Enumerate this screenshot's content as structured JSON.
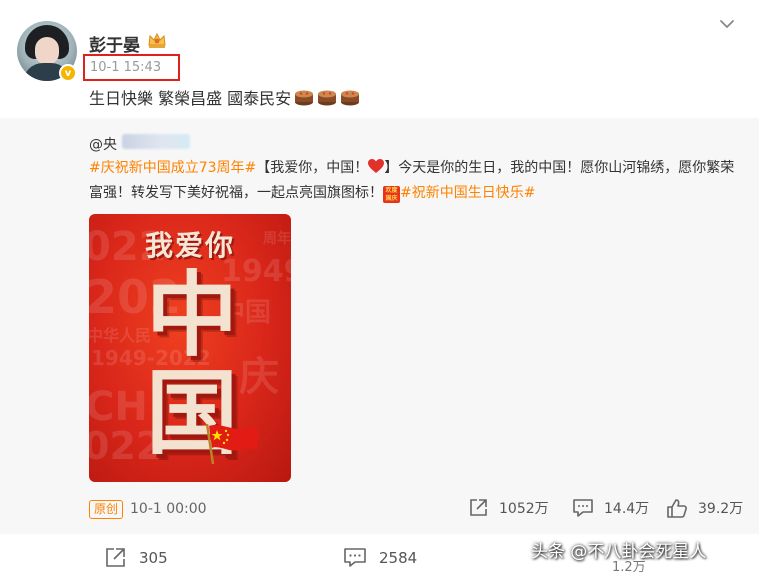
{
  "author": {
    "name": "彭于晏",
    "verified_badge": "v",
    "timestamp": "10-1 15:43"
  },
  "post": {
    "text": "生日快樂 繁榮昌盛 國泰民安",
    "emoji": [
      "cake-icon",
      "cake-icon",
      "cake-icon"
    ]
  },
  "repost": {
    "original_author": "@央",
    "tag_start": "#庆祝新中国成立73周年#",
    "text_a": "【我爱你，中国！",
    "text_b": "】今天是你的生日，我的中国！愿你山河锦绣，愿你繁荣富强！转发写下美好祝福，一起点亮国旗图标！",
    "flag_emoji_text": "欢度国庆",
    "tag_end": "#祝新中国生日快乐#",
    "poster": {
      "heading": "我爱你",
      "char1": "中",
      "char2": "国",
      "bg_texts": [
        "022",
        "1949",
        "202",
        "中国",
        "庆",
        "中华人民",
        "1949-2022",
        "CH",
        "周年"
      ]
    },
    "source_badge": "原创",
    "source_time": "10-1 00:00",
    "stats": {
      "reposts": "1052万",
      "comments": "14.4万",
      "likes": "39.2万"
    }
  },
  "footer": {
    "reposts": "305",
    "comments": "2584",
    "likes_partial": "1.2万"
  },
  "watermark": "头条 @不八卦会死星人",
  "colors": {
    "accent": "#ff8200",
    "highlight_box": "#e0211a",
    "poster_red": "#d9261a"
  }
}
